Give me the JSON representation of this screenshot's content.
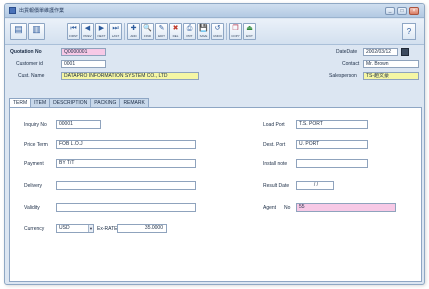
{
  "window": {
    "title": "出貨報價單維護作業",
    "min_label": "_",
    "max_label": "□",
    "close_label": "×"
  },
  "toolbar": {
    "buttons": [
      {
        "icon": "list-icon",
        "glyph": "▤",
        "caption": ""
      },
      {
        "icon": "form-icon",
        "glyph": "▥",
        "caption": ""
      },
      {
        "icon": "first-icon",
        "glyph": "⏮",
        "caption": "FIRST"
      },
      {
        "icon": "prev-icon",
        "glyph": "◀",
        "caption": "PREV"
      },
      {
        "icon": "next-icon",
        "glyph": "▶",
        "caption": "NEXT"
      },
      {
        "icon": "last-icon",
        "glyph": "⏭",
        "caption": "LAST"
      },
      {
        "icon": "add-icon",
        "glyph": "✚",
        "caption": "ADD"
      },
      {
        "icon": "search-icon",
        "glyph": "🔍",
        "caption": "FIND"
      },
      {
        "icon": "edit-icon",
        "glyph": "✎",
        "caption": "EDIT"
      },
      {
        "icon": "delete-icon",
        "glyph": "✖",
        "caption": "DEL"
      },
      {
        "icon": "print-icon",
        "glyph": "⎙",
        "caption": "PRT"
      },
      {
        "icon": "save-icon",
        "glyph": "💾",
        "caption": "SAVE"
      },
      {
        "icon": "cancel-icon",
        "glyph": "↺",
        "caption": "UNDO"
      },
      {
        "icon": "copy-icon",
        "glyph": "❐",
        "caption": "COPY"
      },
      {
        "icon": "exit-icon",
        "glyph": "⏏",
        "caption": "EXIT"
      }
    ],
    "right_icon": "help-icon",
    "right_glyph": "?"
  },
  "header": {
    "quotation_no_label": "Quotation No",
    "quotation_no": "Q0000001",
    "customer_label": "Customer id",
    "customer_id": "0001",
    "cust_name_label": "Cust. Name",
    "cust_name": "DATAPRO INFORMATION SYSTEM CO., LTD",
    "date_label": "DateDate",
    "date": "2002/03/12",
    "contact_label": "Contact",
    "contact": "Mr. Brown",
    "salesperson_label": "Salesperson",
    "salesperson": "TS-趙文豪"
  },
  "tabs": [
    "TERM",
    "ITEM",
    "DESCRIPTION",
    "PACKING",
    "REMARK"
  ],
  "term": {
    "inquiry_label": "Inquiry No",
    "inquiry_no": "00001",
    "price_term_label": "Price Term",
    "price_term": "FOB L.O.J",
    "payment_label": "Payment",
    "payment": "BY T/T",
    "delivery_label": "Delivery",
    "delivery": "",
    "validity_label": "Validity",
    "validity": "",
    "currency_label": "Currency",
    "currency": "USD",
    "rate_label": "Ex-RATE",
    "rate": "35.0000",
    "load_port_label": "Load Port",
    "load_port": "T.S. PORT",
    "dest_port_label": "Dest. Port",
    "dest_port": "U. PORT",
    "installment_label": "Install note",
    "installment": "",
    "result_date_label": "Result Date",
    "result_date": "/ /",
    "agent_label": "Agent",
    "agent_no_label": "No",
    "agent": "55"
  }
}
